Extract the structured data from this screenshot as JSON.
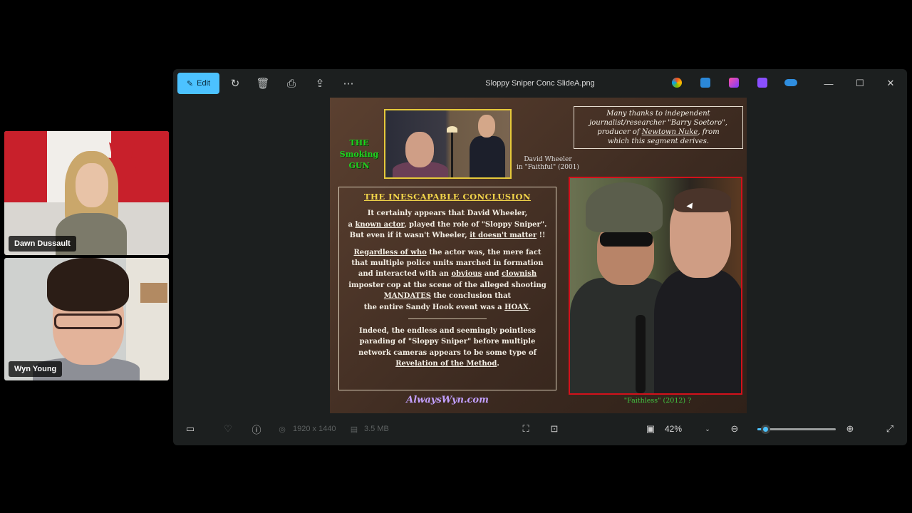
{
  "participants": [
    {
      "name": "Dawn Dussault"
    },
    {
      "name": "Wyn Young"
    }
  ],
  "viewer": {
    "title": "Sloppy Sniper Conc SlideA.png",
    "edit_label": "Edit",
    "toolbar_icons": [
      "rotate-icon",
      "delete-icon",
      "print-icon",
      "share-icon",
      "more-icon"
    ],
    "app_icons": [
      "copilot-icon",
      "designer-icon",
      "clipchamp-icon",
      "paint-icon",
      "onedrive-icon"
    ],
    "window_controls": {
      "minimize": "—",
      "maximize": "☐",
      "close": "✕"
    },
    "bottom": {
      "dimensions": "1920 x 1440",
      "file_size": "3.5 MB",
      "zoom": "42%",
      "zoom_level": 0.1
    }
  },
  "slide": {
    "smoking_gun": [
      "THE",
      "Smoking",
      "GUN"
    ],
    "caption_top": [
      "David Wheeler",
      "in \"Faithful\" (2001)"
    ],
    "thanks": {
      "line1": "Many thanks to independent",
      "line2": "journalist/researcher \"Barry Soetoro\",",
      "line3_pre": "producer of ",
      "line3_ul": "Newtown Nuke",
      "line3_post": ", from",
      "line4": "which this segment derives."
    },
    "conclusion": {
      "title": "THE INESCAPABLE CONCLUSION",
      "p1_line1": "It certainly appears that David Wheeler,",
      "p1_line2_pre": "a ",
      "p1_line2_ul": "known actor",
      "p1_line2_post": ", played the role of \"Sloppy Sniper\".",
      "p1_line3_pre": "But even if it wasn't Wheeler, ",
      "p1_line3_ul": "it doesn't matter",
      "p1_line3_post": " !!",
      "p2_ul1": "Regardless of who",
      "p2_l1_post": " the actor was, the mere fact",
      "p2_l2": "that multiple police units marched in formation",
      "p2_l3_pre": "and interacted with an ",
      "p2_l3_ul1": "obvious",
      "p2_l3_mid": " and ",
      "p2_l3_ul2": "clownish",
      "p2_l4": "imposter cop at the scene of the alleged shooting",
      "p2_ul_mandates": "MANDATES",
      "p2_l5_post": " the conclusion that",
      "p2_l6_pre": "the entire Sandy Hook event was a ",
      "p2_l6_ul": "HOAX",
      "p2_l6_post": ".",
      "p3_l1": "Indeed, the endless and seemingly pointless",
      "p3_l2": "parading of \"Sloppy Sniper\" before multiple",
      "p3_l3": "network cameras appears to be some type of",
      "p3_ul": "Revelation of the Method",
      "p3_l4_post": "."
    },
    "signature": "AlwaysWyn.com",
    "caption_bottom": "\"Faithless\" (2012) ?"
  },
  "colors": {
    "accent": "#4cc2ff",
    "smoking_gun": "#1fd31f",
    "conclusion_title": "#f2d54a",
    "photo_border": "#d3111b"
  }
}
